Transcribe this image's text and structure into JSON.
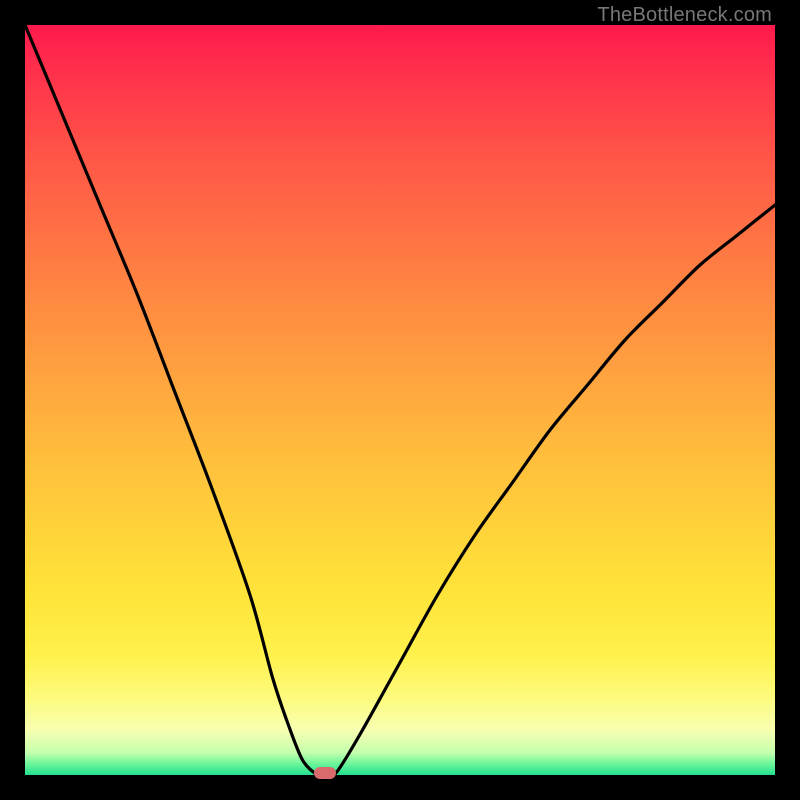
{
  "watermark": "TheBottleneck.com",
  "colors": {
    "background": "#000000",
    "gradient_top": "#ff1a4d",
    "gradient_bottom": "#22df8e",
    "curve": "#000000",
    "marker": "#d96b6d"
  },
  "chart_data": {
    "type": "line",
    "title": "",
    "xlabel": "",
    "ylabel": "",
    "xlim": [
      0,
      100
    ],
    "ylim": [
      0,
      100
    ],
    "grid": false,
    "legend": false,
    "series": [
      {
        "name": "bottleneck-curve",
        "x": [
          0,
          5,
          10,
          15,
          20,
          25,
          30,
          33,
          35,
          37,
          39,
          40,
          41,
          42,
          45,
          50,
          55,
          60,
          65,
          70,
          75,
          80,
          85,
          90,
          95,
          100
        ],
        "values": [
          100,
          88,
          76,
          64,
          51,
          38,
          24,
          13,
          7,
          2,
          0,
          0,
          0,
          1,
          6,
          15,
          24,
          32,
          39,
          46,
          52,
          58,
          63,
          68,
          72,
          76
        ]
      }
    ],
    "annotations": [
      {
        "name": "optimal-marker",
        "x": 40,
        "y": 0
      }
    ],
    "background_gradient": {
      "direction": "vertical",
      "stops": [
        {
          "pos": 0.0,
          "color": "#ff1a4d"
        },
        {
          "pos": 0.5,
          "color": "#ffa63f"
        },
        {
          "pos": 0.85,
          "color": "#fff14c"
        },
        {
          "pos": 1.0,
          "color": "#22df8e"
        }
      ]
    }
  }
}
